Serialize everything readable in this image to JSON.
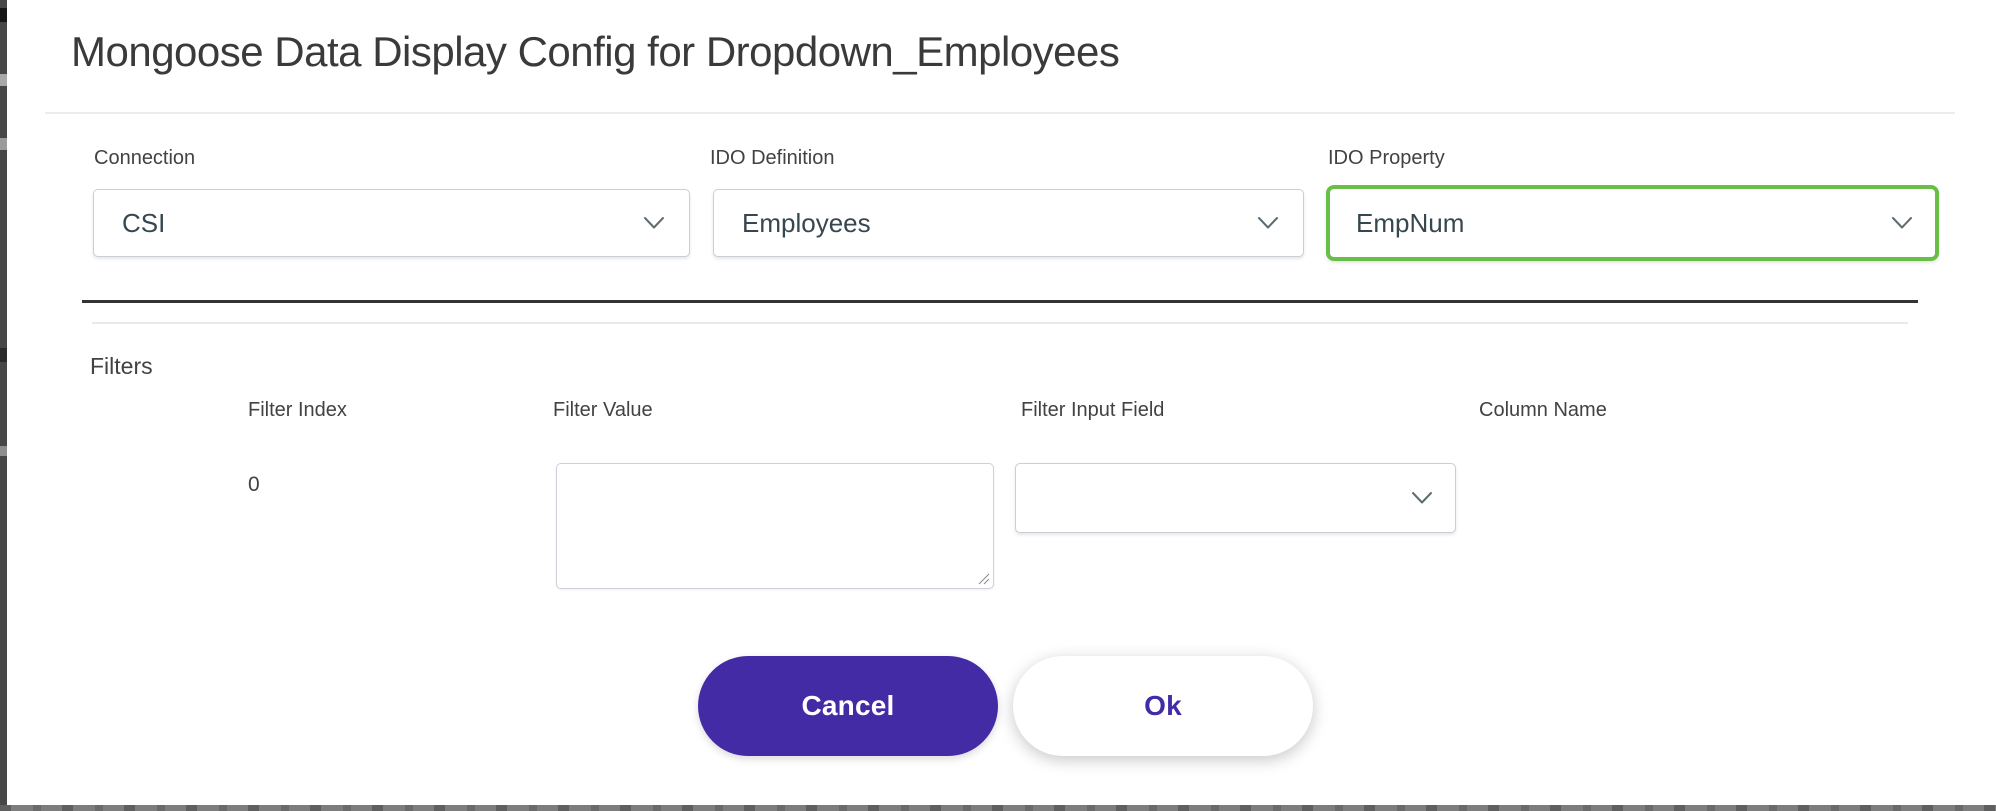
{
  "dialog": {
    "title": "Mongoose Data Display Config for Dropdown_Employees",
    "fields": [
      {
        "label": "Connection",
        "value": "CSI",
        "highlighted": false
      },
      {
        "label": "IDO Definition",
        "value": "Employees",
        "highlighted": false
      },
      {
        "label": "IDO Property",
        "value": "EmpNum",
        "highlighted": true
      }
    ],
    "filters": {
      "section_label": "Filters",
      "columns": [
        "Filter Index",
        "Filter Value",
        "Filter Input Field",
        "Column Name"
      ],
      "rows": [
        {
          "filter_index": "0",
          "filter_value": "",
          "filter_input_field": "",
          "column_name": ""
        }
      ]
    },
    "buttons": {
      "cancel": "Cancel",
      "ok": "Ok"
    },
    "icons": {
      "dropdown": "chevron-down-icon",
      "textarea_corner": "resize-handle-icon"
    },
    "colors": {
      "accent_purple": "#442ba6",
      "highlight_green": "#69be47"
    }
  }
}
